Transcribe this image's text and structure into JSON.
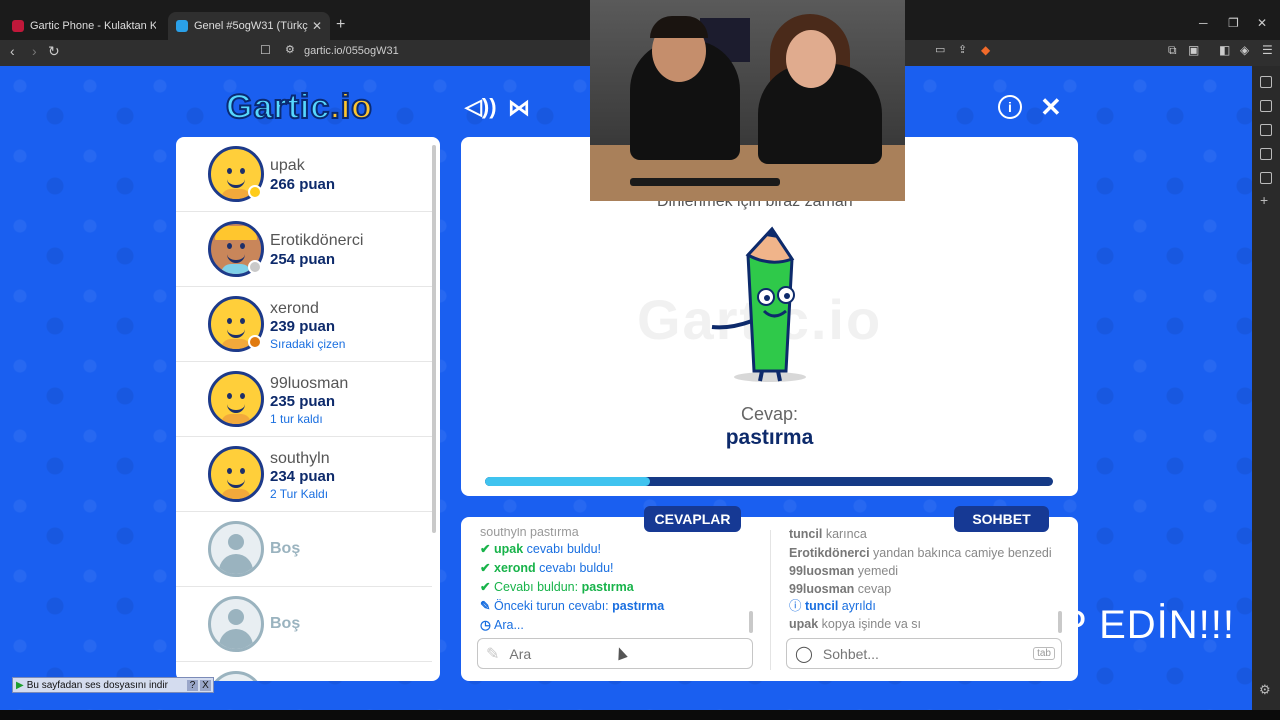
{
  "browser": {
    "tabs": [
      {
        "title": "Gartic Phone - Kulaktan Kulağa",
        "favicon_color": "#c0183a"
      },
      {
        "title": "Genel #5ogW31 (Türkçe) - Gartic",
        "favicon_color": "#2aa0e8"
      }
    ],
    "new_tab_label": "+",
    "url": "gartic.io/055ogW31"
  },
  "game": {
    "logo_text": "Gartic",
    "logo_suffix": ".io",
    "players": [
      {
        "name": "upak",
        "points": "266 puan",
        "note": "",
        "avatar": "smile",
        "status_color": "#ffcc1a"
      },
      {
        "name": "Erotikdönerci",
        "points": "254 puan",
        "note": "",
        "avatar": "cap",
        "status_color": "#c9c9c9"
      },
      {
        "name": "xerond",
        "points": "239 puan",
        "note": "Sıradaki çizen",
        "avatar": "smile",
        "status_color": "#e07a10"
      },
      {
        "name": "99luosman",
        "points": "235 puan",
        "note": "1 tur kaldı",
        "avatar": "smile",
        "status_color": ""
      },
      {
        "name": "southyln",
        "points": "234 puan",
        "note": "2 Tur Kaldı",
        "avatar": "smile",
        "status_color": ""
      }
    ],
    "empty_slots": [
      "Boş",
      "Boş"
    ],
    "wait_text": "Dinlenmek için biraz zaman",
    "watermark": "Gartic.io",
    "answer_label": "Cevap:",
    "answer_value": "pastırma",
    "progress": 0.29,
    "answers_button": "CEVAPLAR",
    "chat_button": "SOHBET",
    "answers": [
      {
        "icon": "",
        "who": "",
        "text": "southyln pastırma"
      },
      {
        "icon": "check",
        "who": "upak",
        "text": " cevabı buldu!"
      },
      {
        "icon": "check",
        "who": "xerond",
        "text": " cevabı buldu!"
      },
      {
        "icon": "check",
        "who": "",
        "text": "Cevabı buldun: ",
        "strong": "pastırma"
      },
      {
        "icon": "pencil",
        "who": "",
        "text": "Önceki turun cevabı: ",
        "strong": "pastırma"
      },
      {
        "icon": "clock",
        "who": "",
        "text": "Ara..."
      }
    ],
    "chat": [
      {
        "who": "tuncil",
        "text": " karınca"
      },
      {
        "who": "Erotikdönerci",
        "text": " yandan bakınca camiye benzedi"
      },
      {
        "who": "99luosman",
        "text": " yemedi"
      },
      {
        "who": "99luosman",
        "text": " cevap"
      },
      {
        "who": "tuncil",
        "text": " ayrıldı",
        "info": true
      },
      {
        "who": "upak",
        "text": " kopya işinde va sı"
      }
    ],
    "answer_input_placeholder": "Ara",
    "chat_input_placeholder": "Sohbet...",
    "tab_key": "tab"
  },
  "overlay": {
    "cta_text": "P EDİN!!!",
    "download_bar": "Bu sayfadan ses dosyasını indir",
    "download_help": "?",
    "download_close": "X"
  },
  "colors": {
    "background": "#1a5ff0",
    "navy": "#163994",
    "accent": "#3fc3ef"
  }
}
